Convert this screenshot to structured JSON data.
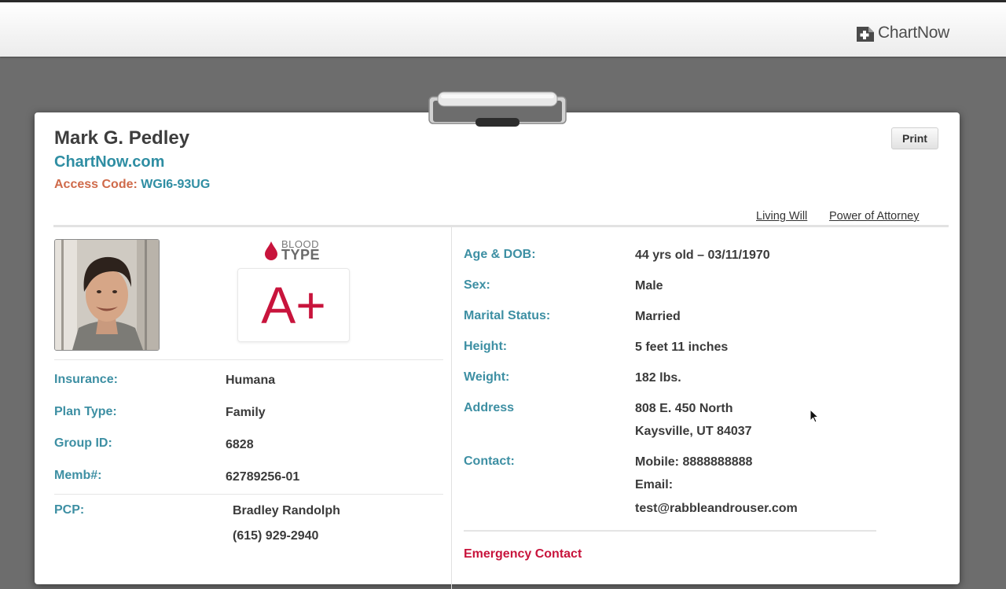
{
  "app": {
    "brand": "ChartNow",
    "brand_icon": "medical-cross-icon"
  },
  "header": {
    "patient_name": "Mark G. Pedley",
    "site": "ChartNow.com",
    "access_label": "Access Code:",
    "access_code": "WGI6-93UG",
    "print_label": "Print",
    "links": [
      "Living Will",
      "Power of Attorney"
    ]
  },
  "blood": {
    "label_small": "BLOOD",
    "label_big": "TYPE",
    "value": "A+"
  },
  "insurance": {
    "insurance_label": "Insurance:",
    "insurance_value": "Humana",
    "plan_label": "Plan Type:",
    "plan_value": "Family",
    "group_label": "Group ID:",
    "group_value": "6828",
    "memb_label": "Memb#:",
    "memb_value": "62789256-01"
  },
  "pcp": {
    "label": "PCP:",
    "name": "Bradley Randolph",
    "phone": "(615) 929-2940"
  },
  "details": {
    "age_label": "Age & DOB:",
    "age_value": "44 yrs old – 03/11/1970",
    "sex_label": "Sex:",
    "sex_value": "Male",
    "marital_label": "Marital Status:",
    "marital_value": "Married",
    "height_label": "Height:",
    "height_value": "5 feet 11 inches",
    "weight_label": "Weight:",
    "weight_value": "182 lbs.",
    "address_label": "Address",
    "address_line1": "808 E. 450 North",
    "address_line2": "Kaysville, UT 84037",
    "contact_label": "Contact:",
    "contact_mobile": "Mobile: 8888888888",
    "contact_email_label": "Email:",
    "contact_email": "test@rabbleandrouser.com"
  },
  "emergency": {
    "title": "Emergency Contact"
  },
  "colors": {
    "accent_teal": "#3d8fa3",
    "blood_red": "#c8143c",
    "access_orange": "#cf6a4a"
  }
}
